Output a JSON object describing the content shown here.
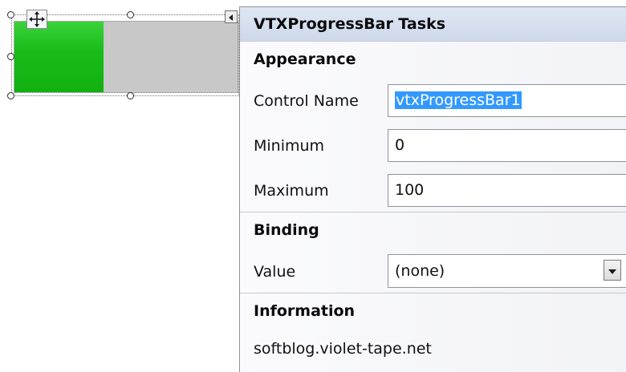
{
  "designer": {
    "control": "VTXProgressBar",
    "progress_fraction": 0.4
  },
  "panel": {
    "title": "VTXProgressBar Tasks",
    "sections": {
      "appearance": "Appearance",
      "binding": "Binding",
      "information": "Information"
    },
    "fields": {
      "control_name_label": "Control Name",
      "control_name_value": "vtxProgressBar1",
      "minimum_label": "Minimum",
      "minimum_value": "0",
      "maximum_label": "Maximum",
      "maximum_value": "100",
      "value_label": "Value",
      "value_selected": "(none)"
    },
    "info_text": "softblog.violet-tape.net"
  },
  "icons": {
    "move": "move-arrows-icon",
    "smart_tag": "smart-tag-arrow-icon",
    "dropdown": "dropdown-arrow-icon"
  },
  "colors": {
    "progress_fill": "#19bd19",
    "progress_track": "#c8c8c8",
    "panel_header": "#d6e0f0",
    "selection": "#3399ff"
  }
}
